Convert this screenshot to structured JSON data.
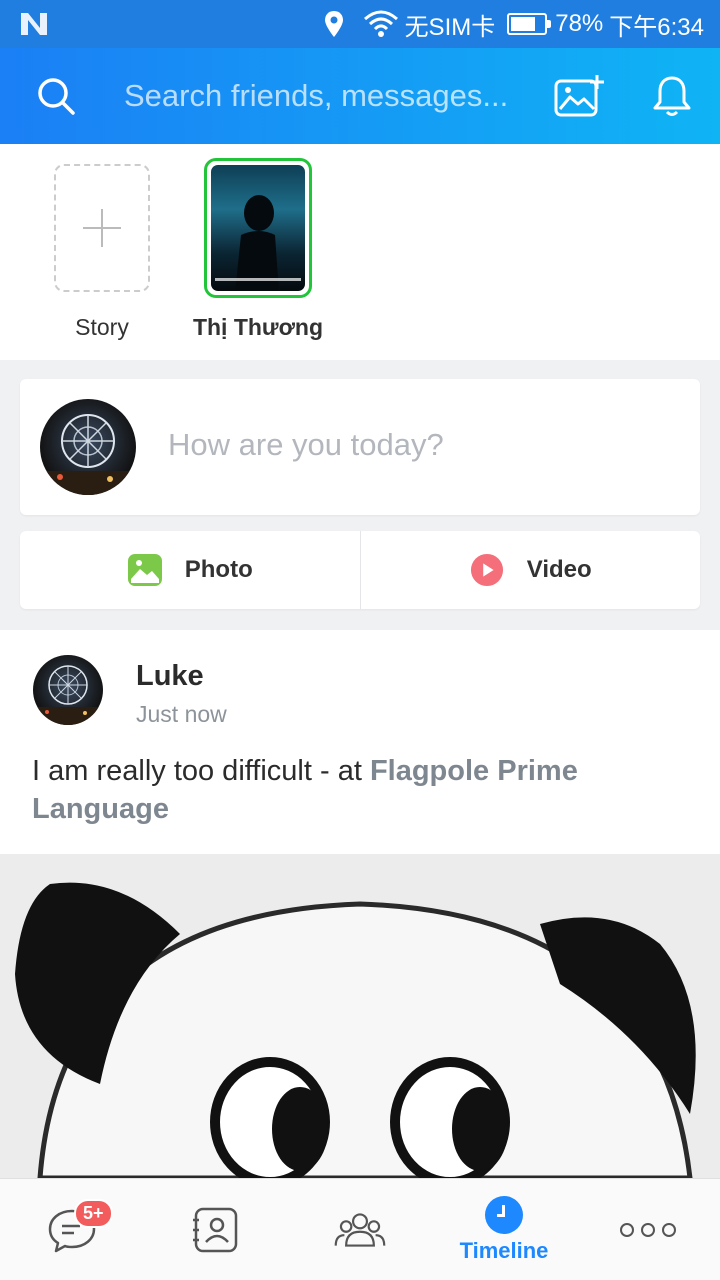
{
  "status_bar": {
    "carrier": "无SIM卡",
    "battery": "78%",
    "battery_level": 0.78,
    "time": "下午6:34",
    "icons": [
      "n-logo-icon",
      "location-icon",
      "wifi-icon",
      "battery-icon"
    ]
  },
  "header": {
    "search_placeholder": "Search friends, messages...",
    "icons": [
      "search-icon",
      "add-photo-icon",
      "bell-icon"
    ]
  },
  "stories": {
    "add_label": "Story",
    "items": [
      {
        "name": "Thị Thương"
      }
    ]
  },
  "compose": {
    "prompt": "How are you today?",
    "photo_label": "Photo",
    "video_label": "Video"
  },
  "post": {
    "author": "Luke",
    "time": "Just now",
    "text": "I am really too difficult - at ",
    "place": "Flagpole Prime Language"
  },
  "bottom_nav": {
    "messages_badge": "5+",
    "timeline_label": "Timeline",
    "icons": [
      "chat-icon",
      "contacts-icon",
      "group-icon",
      "timeline-icon",
      "more-icon"
    ]
  },
  "colors": {
    "header_start": "#1b7ff5",
    "header_end": "#0fb4f5",
    "accent": "#1e88ff",
    "story_ring": "#22c43a",
    "badge": "#f25c5c"
  }
}
